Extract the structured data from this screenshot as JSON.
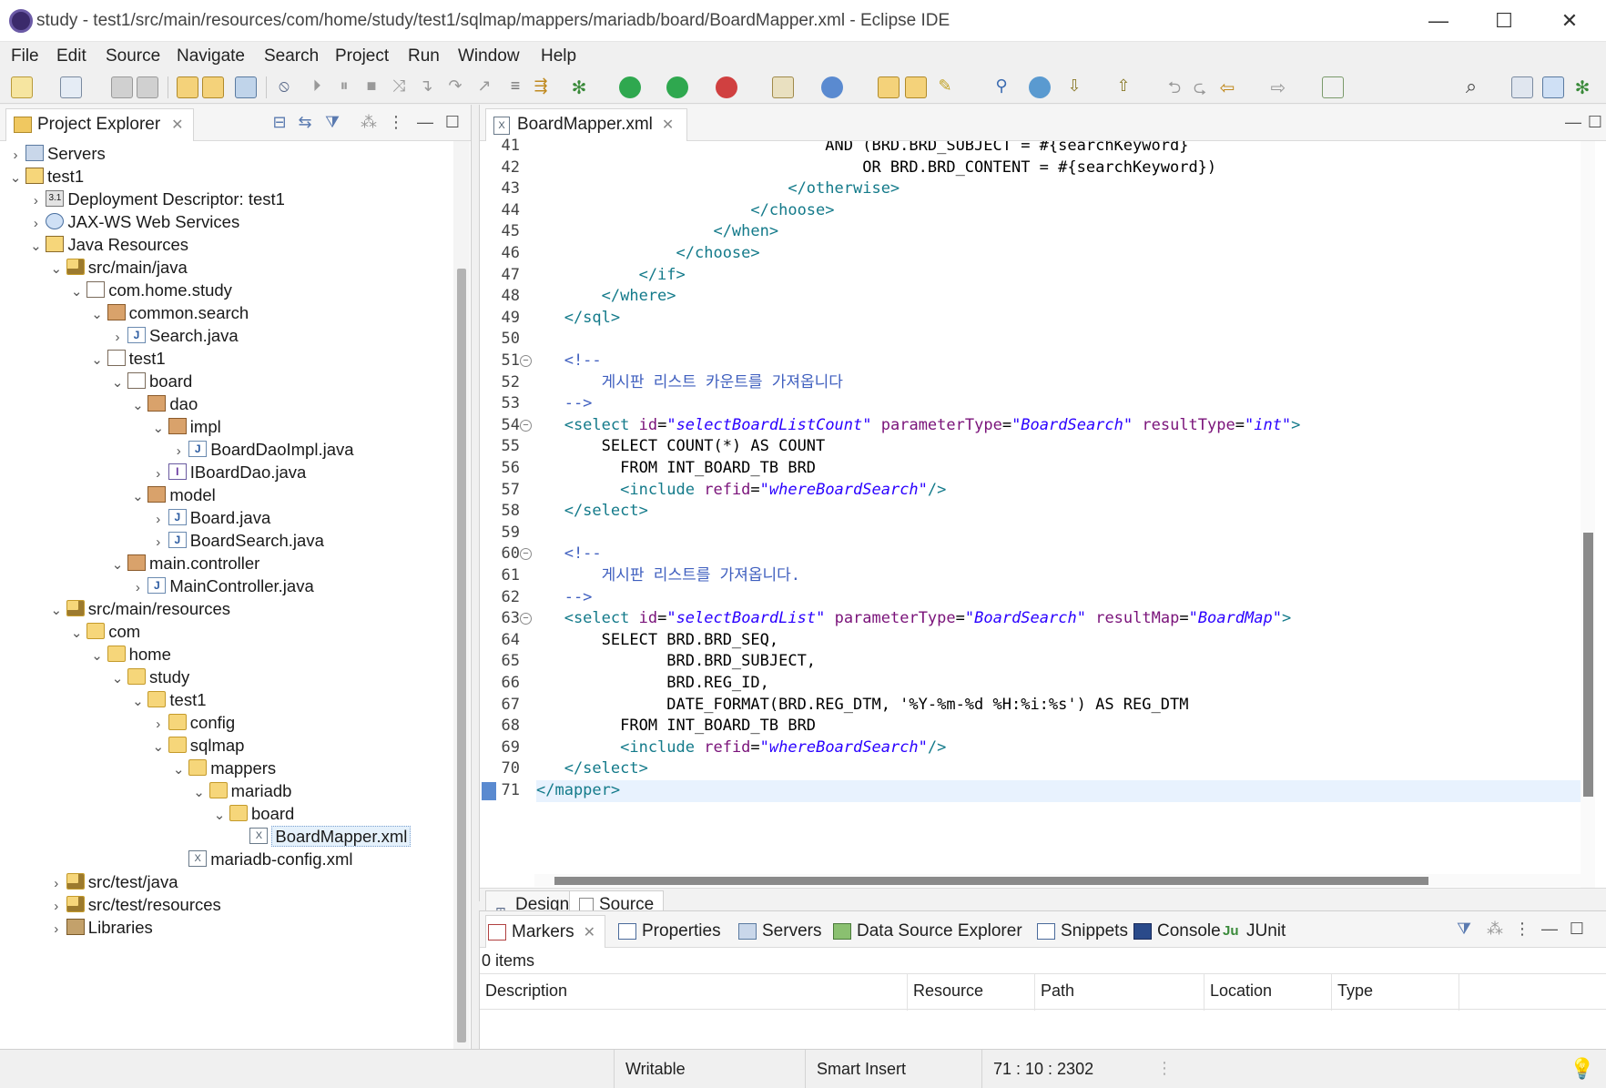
{
  "window": {
    "title": "study - test1/src/main/resources/com/home/study/test1/sqlmap/mappers/mariadb/board/BoardMapper.xml - Eclipse IDE",
    "minimize": "—",
    "maximize": "☐",
    "close": "✕"
  },
  "menu": [
    "File",
    "Edit",
    "Source",
    "Navigate",
    "Search",
    "Project",
    "Run",
    "Window",
    "Help"
  ],
  "project_explorer": {
    "tab_label": "Project Explorer",
    "tree": [
      {
        "label": "Servers",
        "depth": 0,
        "icon": "server-folder-icon",
        "chev": "›"
      },
      {
        "label": "test1",
        "depth": 0,
        "icon": "project-icon",
        "chev": "⌄"
      },
      {
        "label": "Deployment Descriptor: test1",
        "depth": 1,
        "icon": "deployment-descriptor-icon",
        "chev": "›"
      },
      {
        "label": "JAX-WS Web Services",
        "depth": 1,
        "icon": "web-services-icon",
        "chev": "›"
      },
      {
        "label": "Java Resources",
        "depth": 1,
        "icon": "java-resources-icon",
        "chev": "⌄"
      },
      {
        "label": "src/main/java",
        "depth": 2,
        "icon": "source-folder-icon",
        "chev": "⌄"
      },
      {
        "label": "com.home.study",
        "depth": 3,
        "icon": "empty-package-icon",
        "chev": "⌄"
      },
      {
        "label": "common.search",
        "depth": 4,
        "icon": "package-icon",
        "chev": "⌄"
      },
      {
        "label": "Search.java",
        "depth": 5,
        "icon": "java-file-icon",
        "chev": "›"
      },
      {
        "label": "test1",
        "depth": 4,
        "icon": "empty-package-icon",
        "chev": "⌄"
      },
      {
        "label": "board",
        "depth": 5,
        "icon": "empty-package-icon",
        "chev": "⌄"
      },
      {
        "label": "dao",
        "depth": 6,
        "icon": "package-icon",
        "chev": "⌄"
      },
      {
        "label": "impl",
        "depth": 7,
        "icon": "package-icon",
        "chev": "⌄"
      },
      {
        "label": "BoardDaoImpl.java",
        "depth": 8,
        "icon": "java-file-icon",
        "chev": "›"
      },
      {
        "label": "IBoardDao.java",
        "depth": 7,
        "icon": "interface-file-icon",
        "chev": "›"
      },
      {
        "label": "model",
        "depth": 6,
        "icon": "package-icon",
        "chev": "⌄"
      },
      {
        "label": "Board.java",
        "depth": 7,
        "icon": "java-file-icon",
        "chev": "›"
      },
      {
        "label": "BoardSearch.java",
        "depth": 7,
        "icon": "java-file-icon",
        "chev": "›"
      },
      {
        "label": "main.controller",
        "depth": 5,
        "icon": "package-icon",
        "chev": "⌄"
      },
      {
        "label": "MainController.java",
        "depth": 6,
        "icon": "java-file-icon",
        "chev": "›"
      },
      {
        "label": "src/main/resources",
        "depth": 2,
        "icon": "source-folder-icon",
        "chev": "⌄"
      },
      {
        "label": "com",
        "depth": 3,
        "icon": "folder-icon",
        "chev": "⌄"
      },
      {
        "label": "home",
        "depth": 4,
        "icon": "folder-icon",
        "chev": "⌄"
      },
      {
        "label": "study",
        "depth": 5,
        "icon": "folder-icon",
        "chev": "⌄"
      },
      {
        "label": "test1",
        "depth": 6,
        "icon": "folder-icon",
        "chev": "⌄"
      },
      {
        "label": "config",
        "depth": 7,
        "icon": "folder-icon",
        "chev": "›"
      },
      {
        "label": "sqlmap",
        "depth": 7,
        "icon": "folder-icon",
        "chev": "⌄"
      },
      {
        "label": "mappers",
        "depth": 8,
        "icon": "folder-icon",
        "chev": "⌄"
      },
      {
        "label": "mariadb",
        "depth": 9,
        "icon": "folder-icon",
        "chev": "⌄"
      },
      {
        "label": "board",
        "depth": 10,
        "icon": "folder-icon",
        "chev": "⌄"
      },
      {
        "label": "BoardMapper.xml",
        "depth": 11,
        "icon": "xml-file-icon",
        "chev": "",
        "selected": true
      },
      {
        "label": "mariadb-config.xml",
        "depth": 8,
        "icon": "xml-file-icon",
        "chev": ""
      },
      {
        "label": "src/test/java",
        "depth": 2,
        "icon": "source-folder-icon",
        "chev": "›"
      },
      {
        "label": "src/test/resources",
        "depth": 2,
        "icon": "source-folder-icon",
        "chev": "›"
      },
      {
        "label": "Libraries",
        "depth": 2,
        "icon": "library-icon",
        "chev": "›"
      }
    ]
  },
  "editor": {
    "tab_label": "BoardMapper.xml",
    "lines": [
      {
        "n": "41",
        "fold": false,
        "segs": [
          [
            "pln",
            "                               AND (BRD.BRD_SUBJECT = #{searchKeyword}"
          ]
        ]
      },
      {
        "n": "42",
        "fold": false,
        "segs": [
          [
            "pln",
            "                                   OR BRD.BRD_CONTENT = #{searchKeyword})"
          ]
        ]
      },
      {
        "n": "43",
        "fold": false,
        "segs": [
          [
            "tag",
            "                           </otherwise>"
          ]
        ]
      },
      {
        "n": "44",
        "fold": false,
        "segs": [
          [
            "tag",
            "                       </choose>"
          ]
        ]
      },
      {
        "n": "45",
        "fold": false,
        "segs": [
          [
            "tag",
            "                   </when>"
          ]
        ]
      },
      {
        "n": "46",
        "fold": false,
        "segs": [
          [
            "tag",
            "               </choose>"
          ]
        ]
      },
      {
        "n": "47",
        "fold": false,
        "segs": [
          [
            "tag",
            "           </if>"
          ]
        ]
      },
      {
        "n": "48",
        "fold": false,
        "segs": [
          [
            "tag",
            "       </where>"
          ]
        ]
      },
      {
        "n": "49",
        "fold": false,
        "segs": [
          [
            "tag",
            "   </sql>"
          ]
        ]
      },
      {
        "n": "50",
        "fold": false,
        "segs": [
          [
            "pln",
            ""
          ]
        ]
      },
      {
        "n": "51",
        "fold": true,
        "segs": [
          [
            "cmt",
            "   <!--"
          ]
        ]
      },
      {
        "n": "52",
        "fold": false,
        "segs": [
          [
            "cmt",
            "       게시판 리스트 카운트를 가져옵니다"
          ]
        ]
      },
      {
        "n": "53",
        "fold": false,
        "segs": [
          [
            "cmt",
            "   -->"
          ]
        ]
      },
      {
        "n": "54",
        "fold": true,
        "segs": [
          [
            "tag",
            "   <select "
          ],
          [
            "attr",
            "id"
          ],
          [
            "pln",
            "="
          ],
          [
            "val",
            "\"selectBoardListCount\""
          ],
          [
            "pln",
            " "
          ],
          [
            "attr",
            "parameterType"
          ],
          [
            "pln",
            "="
          ],
          [
            "val",
            "\"BoardSearch\""
          ],
          [
            "pln",
            " "
          ],
          [
            "attr",
            "resultType"
          ],
          [
            "pln",
            "="
          ],
          [
            "val",
            "\"int\""
          ],
          [
            "tag",
            ">"
          ]
        ]
      },
      {
        "n": "55",
        "fold": false,
        "segs": [
          [
            "pln",
            "       SELECT COUNT(*) AS COUNT"
          ]
        ]
      },
      {
        "n": "56",
        "fold": false,
        "segs": [
          [
            "pln",
            "         FROM INT_BOARD_TB BRD"
          ]
        ]
      },
      {
        "n": "57",
        "fold": false,
        "segs": [
          [
            "tag",
            "         <include "
          ],
          [
            "attr",
            "refid"
          ],
          [
            "pln",
            "="
          ],
          [
            "val",
            "\"whereBoardSearch\""
          ],
          [
            "tag",
            "/>"
          ]
        ]
      },
      {
        "n": "58",
        "fold": false,
        "segs": [
          [
            "tag",
            "   </select>"
          ]
        ]
      },
      {
        "n": "59",
        "fold": false,
        "segs": [
          [
            "pln",
            ""
          ]
        ]
      },
      {
        "n": "60",
        "fold": true,
        "segs": [
          [
            "cmt",
            "   <!--"
          ]
        ]
      },
      {
        "n": "61",
        "fold": false,
        "segs": [
          [
            "cmt",
            "       게시판 리스트를 가져옵니다."
          ]
        ]
      },
      {
        "n": "62",
        "fold": false,
        "segs": [
          [
            "cmt",
            "   -->"
          ]
        ]
      },
      {
        "n": "63",
        "fold": true,
        "segs": [
          [
            "tag",
            "   <select "
          ],
          [
            "attr",
            "id"
          ],
          [
            "pln",
            "="
          ],
          [
            "val",
            "\"selectBoardList\""
          ],
          [
            "pln",
            " "
          ],
          [
            "attr",
            "parameterType"
          ],
          [
            "pln",
            "="
          ],
          [
            "val",
            "\"BoardSearch\""
          ],
          [
            "pln",
            " "
          ],
          [
            "attr",
            "resultMap"
          ],
          [
            "pln",
            "="
          ],
          [
            "val",
            "\"BoardMap\""
          ],
          [
            "tag",
            ">"
          ]
        ]
      },
      {
        "n": "64",
        "fold": false,
        "segs": [
          [
            "pln",
            "       SELECT BRD.BRD_SEQ,"
          ]
        ]
      },
      {
        "n": "65",
        "fold": false,
        "segs": [
          [
            "pln",
            "              BRD.BRD_SUBJECT,"
          ]
        ]
      },
      {
        "n": "66",
        "fold": false,
        "segs": [
          [
            "pln",
            "              BRD.REG_ID,"
          ]
        ]
      },
      {
        "n": "67",
        "fold": false,
        "segs": [
          [
            "pln",
            "              DATE_FORMAT(BRD.REG_DTM, '%Y-%m-%d %H:%i:%s') AS REG_DTM"
          ]
        ]
      },
      {
        "n": "68",
        "fold": false,
        "segs": [
          [
            "pln",
            "         FROM INT_BOARD_TB BRD"
          ]
        ]
      },
      {
        "n": "69",
        "fold": false,
        "segs": [
          [
            "tag",
            "         <include "
          ],
          [
            "attr",
            "refid"
          ],
          [
            "pln",
            "="
          ],
          [
            "val",
            "\"whereBoardSearch\""
          ],
          [
            "tag",
            "/>"
          ]
        ]
      },
      {
        "n": "70",
        "fold": false,
        "segs": [
          [
            "tag",
            "   </select>"
          ]
        ]
      },
      {
        "n": "71",
        "fold": false,
        "current": true,
        "segs": [
          [
            "tag",
            "</mapper>"
          ]
        ]
      }
    ],
    "design_tab": "Design",
    "source_tab": "Source"
  },
  "bottom_panel": {
    "tabs": [
      "Markers",
      "Properties",
      "Servers",
      "Data Source Explorer",
      "Snippets",
      "Console",
      "JUnit"
    ],
    "items_count": "0 items",
    "columns": [
      "Description",
      "Resource",
      "Path",
      "Location",
      "Type"
    ]
  },
  "status": {
    "writable": "Writable",
    "insert_mode": "Smart Insert",
    "position": "71 : 10 : 2302"
  }
}
